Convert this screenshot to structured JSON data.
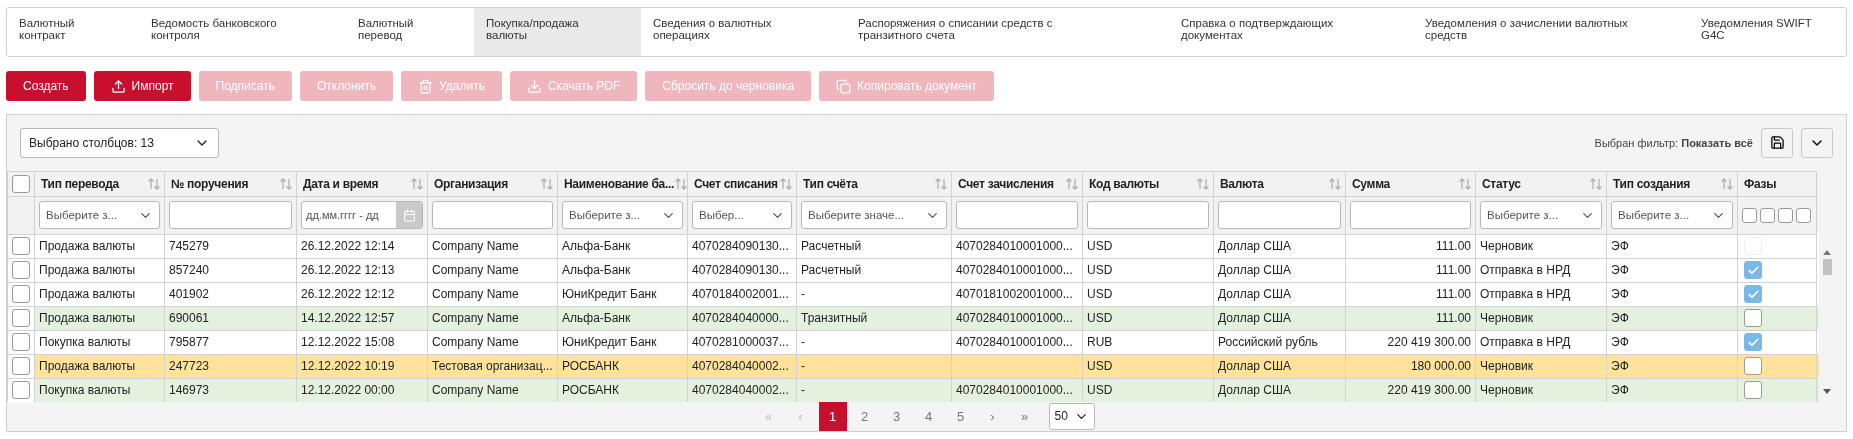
{
  "tabs": [
    {
      "label": "Валютный контракт",
      "selected": false
    },
    {
      "label": "Ведомость банковского контроля",
      "selected": false
    },
    {
      "label": "Валютный перевод",
      "selected": false
    },
    {
      "label": "Покупка/продажа валюты",
      "selected": true
    },
    {
      "label": "Сведения о валютных операциях",
      "selected": false
    },
    {
      "label": "Распоряжения о списании средств с транзитного счета",
      "selected": false
    },
    {
      "label": "Справка о подтверждающих документах",
      "selected": false
    },
    {
      "label": "Уведомления о зачислении валютных средств",
      "selected": false
    },
    {
      "label": "Уведомления SWIFT G4C",
      "selected": false
    }
  ],
  "actions": [
    {
      "label": "Создать",
      "kind": "plain",
      "disabled": false
    },
    {
      "label": "Импорт",
      "kind": "upload",
      "disabled": false
    },
    {
      "label": "Подписать",
      "kind": "plain",
      "disabled": true
    },
    {
      "label": "Отклонить",
      "kind": "plain",
      "disabled": true
    },
    {
      "label": "Удалить",
      "kind": "trash",
      "disabled": true
    },
    {
      "label": "Скачать PDF",
      "kind": "download",
      "disabled": true
    },
    {
      "label": "Сбросить до черновика",
      "kind": "plain",
      "disabled": true
    },
    {
      "label": "Копировать документ",
      "kind": "copy",
      "disabled": true
    }
  ],
  "grid": {
    "columns_select": "Выбрано столбцов: 13",
    "filter_label": "Выбран фильтр:",
    "filter_value": "Показать всё",
    "select_all_checked": false,
    "columns": [
      {
        "label": "Тип перевода",
        "sortable": true,
        "filter": {
          "kind": "select",
          "placeholder": "Выберите з..."
        }
      },
      {
        "label": "№ поручения",
        "sortable": true,
        "filter": {
          "kind": "text"
        }
      },
      {
        "label": "Дата и время",
        "sortable": true,
        "filter": {
          "kind": "date",
          "placeholder": "дд.мм.гггг - дд"
        }
      },
      {
        "label": "Организация",
        "sortable": true,
        "filter": {
          "kind": "text"
        }
      },
      {
        "label": "Наименование ба...",
        "sortable": true,
        "filter": {
          "kind": "select",
          "placeholder": "Выберите з..."
        }
      },
      {
        "label": "Счет списания",
        "sortable": true,
        "filter": {
          "kind": "select",
          "placeholder": "Выбер..."
        }
      },
      {
        "label": "Тип счёта",
        "sortable": true,
        "filter": {
          "kind": "select",
          "placeholder": "Выберите значе..."
        }
      },
      {
        "label": "Счет зачисления",
        "sortable": true,
        "filter": {
          "kind": "text"
        }
      },
      {
        "label": "Код валюты",
        "sortable": true,
        "filter": {
          "kind": "text"
        }
      },
      {
        "label": "Валюта",
        "sortable": true,
        "filter": {
          "kind": "text"
        }
      },
      {
        "label": "Сумма",
        "sortable": true,
        "filter": {
          "kind": "text"
        }
      },
      {
        "label": "Статус",
        "sortable": true,
        "filter": {
          "kind": "select",
          "placeholder": "Выберите з..."
        }
      },
      {
        "label": "Тип создания",
        "sortable": true,
        "filter": {
          "kind": "select",
          "placeholder": "Выберите з..."
        }
      },
      {
        "label": "Фазы",
        "sortable": false,
        "filter": {
          "kind": "phases",
          "phases": [
            {
              "checked": false
            },
            {
              "checked": false
            },
            {
              "checked": false
            },
            {
              "checked": false
            }
          ]
        }
      }
    ],
    "rows": [
      {
        "color": "#ffffff",
        "checked": false,
        "cells": [
          "Продажа валюты",
          "745279",
          "26.12.2022 12:14",
          "Company Name",
          "Альфа-Банк",
          "4070284090130...",
          "Расчетный",
          "4070284010001000...",
          "USD",
          "Доллар США",
          "111.00",
          "Черновик",
          "ЭФ"
        ],
        "phase": {
          "checked": false,
          "disabled": true
        }
      },
      {
        "color": "#ffffff",
        "checked": false,
        "cells": [
          "Продажа валюты",
          "857240",
          "26.12.2022 12:13",
          "Company Name",
          "Альфа-Банк",
          "4070284090130...",
          "Расчетный",
          "4070284010001000...",
          "USD",
          "Доллар США",
          "111.00",
          "Отправка в НРД",
          "ЭФ"
        ],
        "phase": {
          "checked": true,
          "disabled": false
        }
      },
      {
        "color": "#ffffff",
        "checked": false,
        "cells": [
          "Продажа валюты",
          "401902",
          "26.12.2022 12:12",
          "Company Name",
          "ЮниКредит Банк",
          "4070184002001...",
          "-",
          "4070181002001000...",
          "USD",
          "Доллар США",
          "111.00",
          "Отправка в НРД",
          "ЭФ"
        ],
        "phase": {
          "checked": true,
          "disabled": false
        }
      },
      {
        "color": "#e5f1df",
        "checked": false,
        "cells": [
          "Продажа валюты",
          "690061",
          "14.12.2022 12:57",
          "Company Name",
          "Альфа-Банк",
          "4070284040000...",
          "Транзитный",
          "4070284010001000...",
          "USD",
          "Доллар США",
          "111.00",
          "Черновик",
          "ЭФ"
        ],
        "phase": {
          "checked": false,
          "disabled": false
        }
      },
      {
        "color": "#ffffff",
        "checked": false,
        "cells": [
          "Покупка валюты",
          "795877",
          "12.12.2022 15:08",
          "Company Name",
          "ЮниКредит Банк",
          "4070281000037...",
          "-",
          "4070284010001000...",
          "RUB",
          "Российский рубль",
          "220 419 300.00",
          "Отправка в НРД",
          "ЭФ"
        ],
        "phase": {
          "checked": true,
          "disabled": false
        }
      },
      {
        "color": "#ffe39a",
        "checked": false,
        "cells": [
          "Продажа валюты",
          "247723",
          "12.12.2022 10:19",
          "Тестовая организац...",
          "РОСБАНК",
          "4070284040002...",
          "-",
          "",
          "USD",
          "Доллар США",
          "180 000.00",
          "Черновик",
          "ЭФ"
        ],
        "phase": {
          "checked": false,
          "disabled": false
        }
      },
      {
        "color": "#e5f1df",
        "checked": false,
        "cells": [
          "Покупка валюты",
          "146973",
          "12.12.2022 00:00",
          "Company Name",
          "РОСБАНК",
          "4070284040002...",
          "-",
          "4070284010001000...",
          "USD",
          "Доллар США",
          "220 419 300.00",
          "Черновик",
          "ЭФ"
        ],
        "phase": {
          "checked": false,
          "disabled": false
        }
      }
    ],
    "pagination": {
      "first": "«",
      "prev": "‹",
      "next": "›",
      "last": "»",
      "nav_disabled_back": true,
      "pages": [
        {
          "label": "1",
          "selected": true
        },
        {
          "label": "2",
          "selected": false
        },
        {
          "label": "3",
          "selected": false
        },
        {
          "label": "4",
          "selected": false
        },
        {
          "label": "5",
          "selected": false
        }
      ],
      "page_size": "50"
    }
  }
}
